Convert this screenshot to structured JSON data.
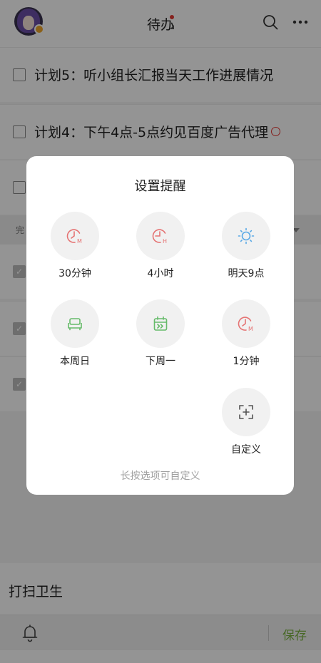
{
  "header": {
    "title": "待办"
  },
  "tasks": [
    {
      "text": "计划5：听小组长汇报当天工作进展情况",
      "checked": false
    },
    {
      "text": "计划4：下午4点-5点约见百度广告代理",
      "checked": false,
      "has_reminder": true
    },
    {
      "checked": false
    },
    {
      "checked": true
    },
    {
      "checked": true
    },
    {
      "checked": true
    }
  ],
  "section": {
    "label": "完"
  },
  "dialog": {
    "title": "设置提醒",
    "options": [
      {
        "label": "30分钟",
        "icon": "clock-m-icon",
        "color": "#e57373"
      },
      {
        "label": "4小时",
        "icon": "clock-h-icon",
        "color": "#e57373"
      },
      {
        "label": "明天9点",
        "icon": "sun-icon",
        "color": "#5aa9e6"
      },
      {
        "label": "本周日",
        "icon": "sofa-icon",
        "color": "#66bb6a"
      },
      {
        "label": "下周一",
        "icon": "calendar-forward-icon",
        "color": "#66bb6a"
      },
      {
        "label": "1分钟",
        "icon": "clock-m-icon",
        "color": "#e57373"
      },
      {
        "label": "自定义",
        "icon": "custom-add-icon",
        "color": "#555555"
      }
    ],
    "hint": "长按选项可自定义"
  },
  "input": {
    "value": "打扫卫生"
  },
  "toolbar": {
    "save_label": "保存",
    "accent": "#7cb342"
  }
}
